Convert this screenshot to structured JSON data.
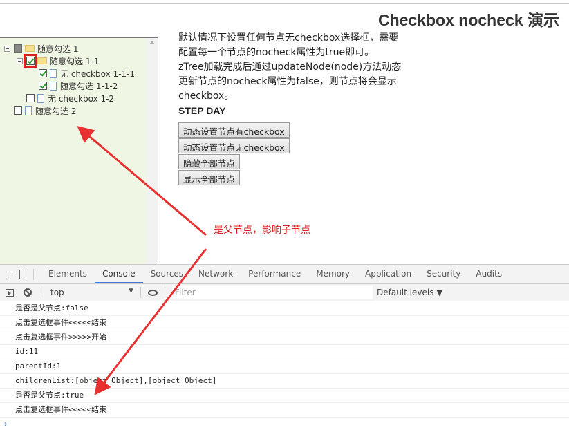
{
  "page": {
    "title": "Checkbox nocheck 演示"
  },
  "tree": {
    "nodes": [
      {
        "label": "随意勾选 1",
        "level": 0,
        "type": "folder",
        "check": "partial",
        "expanded": true
      },
      {
        "label": "随意勾选 1-1",
        "level": 1,
        "type": "folder",
        "check": "checked",
        "expanded": true,
        "highlighted": true
      },
      {
        "label": "无 checkbox 1-1-1",
        "level": 2,
        "type": "file",
        "check": "checked"
      },
      {
        "label": "随意勾选 1-1-2",
        "level": 2,
        "type": "file",
        "check": "checked"
      },
      {
        "label": "无 checkbox 1-2",
        "level": 1,
        "type": "file",
        "check": "unchecked"
      },
      {
        "label": "随意勾选 2",
        "level": 0,
        "type": "file",
        "check": "unchecked"
      }
    ]
  },
  "description": {
    "lines": [
      "默认情况下设置任何节点无checkbox选择框，需要",
      "配置每一个节点的nocheck属性为true即可。",
      "zTree加载完成后通过updateNode(node)方法动态",
      "更新节点的nocheck属性为false，则节点将会显示",
      "checkbox。"
    ],
    "step": "STEP DAY"
  },
  "buttons": {
    "show_checkbox": "动态设置节点有checkbox",
    "hide_checkbox": "动态设置节点无checkbox",
    "hide_all": "隐藏全部节点",
    "show_all": "显示全部节点"
  },
  "annotation": {
    "text": "是父节点，影响子节点",
    "color": "#e02020"
  },
  "devtools": {
    "tabs": [
      "Elements",
      "Console",
      "Sources",
      "Network",
      "Performance",
      "Memory",
      "Application",
      "Security",
      "Audits"
    ],
    "active_tab": "Console",
    "context": "top",
    "filter_placeholder": "Filter",
    "levels": "Default levels ▼",
    "logs": [
      "是否是父节点:false",
      "点击复选框事件<<<<<结束",
      "点击复选框事件>>>>>开始",
      "id:11",
      "parentId:1",
      "childrenList:[object Object],[object Object]",
      "是否是父节点:true",
      "点击复选框事件<<<<<结束"
    ],
    "prompt": "›"
  }
}
